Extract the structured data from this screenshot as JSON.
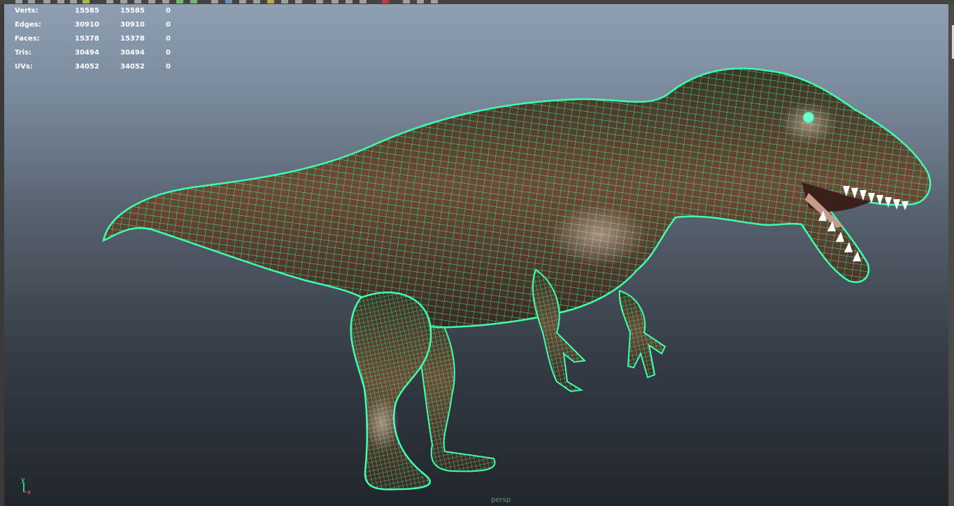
{
  "hud": {
    "rows": [
      {
        "label": "Verts:",
        "object": "15585",
        "selected": "15585",
        "component": "0"
      },
      {
        "label": "Edges:",
        "object": "30910",
        "selected": "30910",
        "component": "0"
      },
      {
        "label": "Faces:",
        "object": "15378",
        "selected": "15378",
        "component": "0"
      },
      {
        "label": "Tris:",
        "object": "30494",
        "selected": "30494",
        "component": "0"
      },
      {
        "label": "UVs:",
        "object": "34052",
        "selected": "34052",
        "component": "0"
      }
    ]
  },
  "viewport": {
    "camera": "persp",
    "axis_labels": {
      "y": "y",
      "x": "x"
    },
    "model_icon": "dinosaur-wireframe-model"
  },
  "colors": {
    "wireframe": "#3dffb0",
    "skin": "#6e4a35",
    "background_top": "#90a0b4",
    "background_bottom": "#22262c"
  }
}
